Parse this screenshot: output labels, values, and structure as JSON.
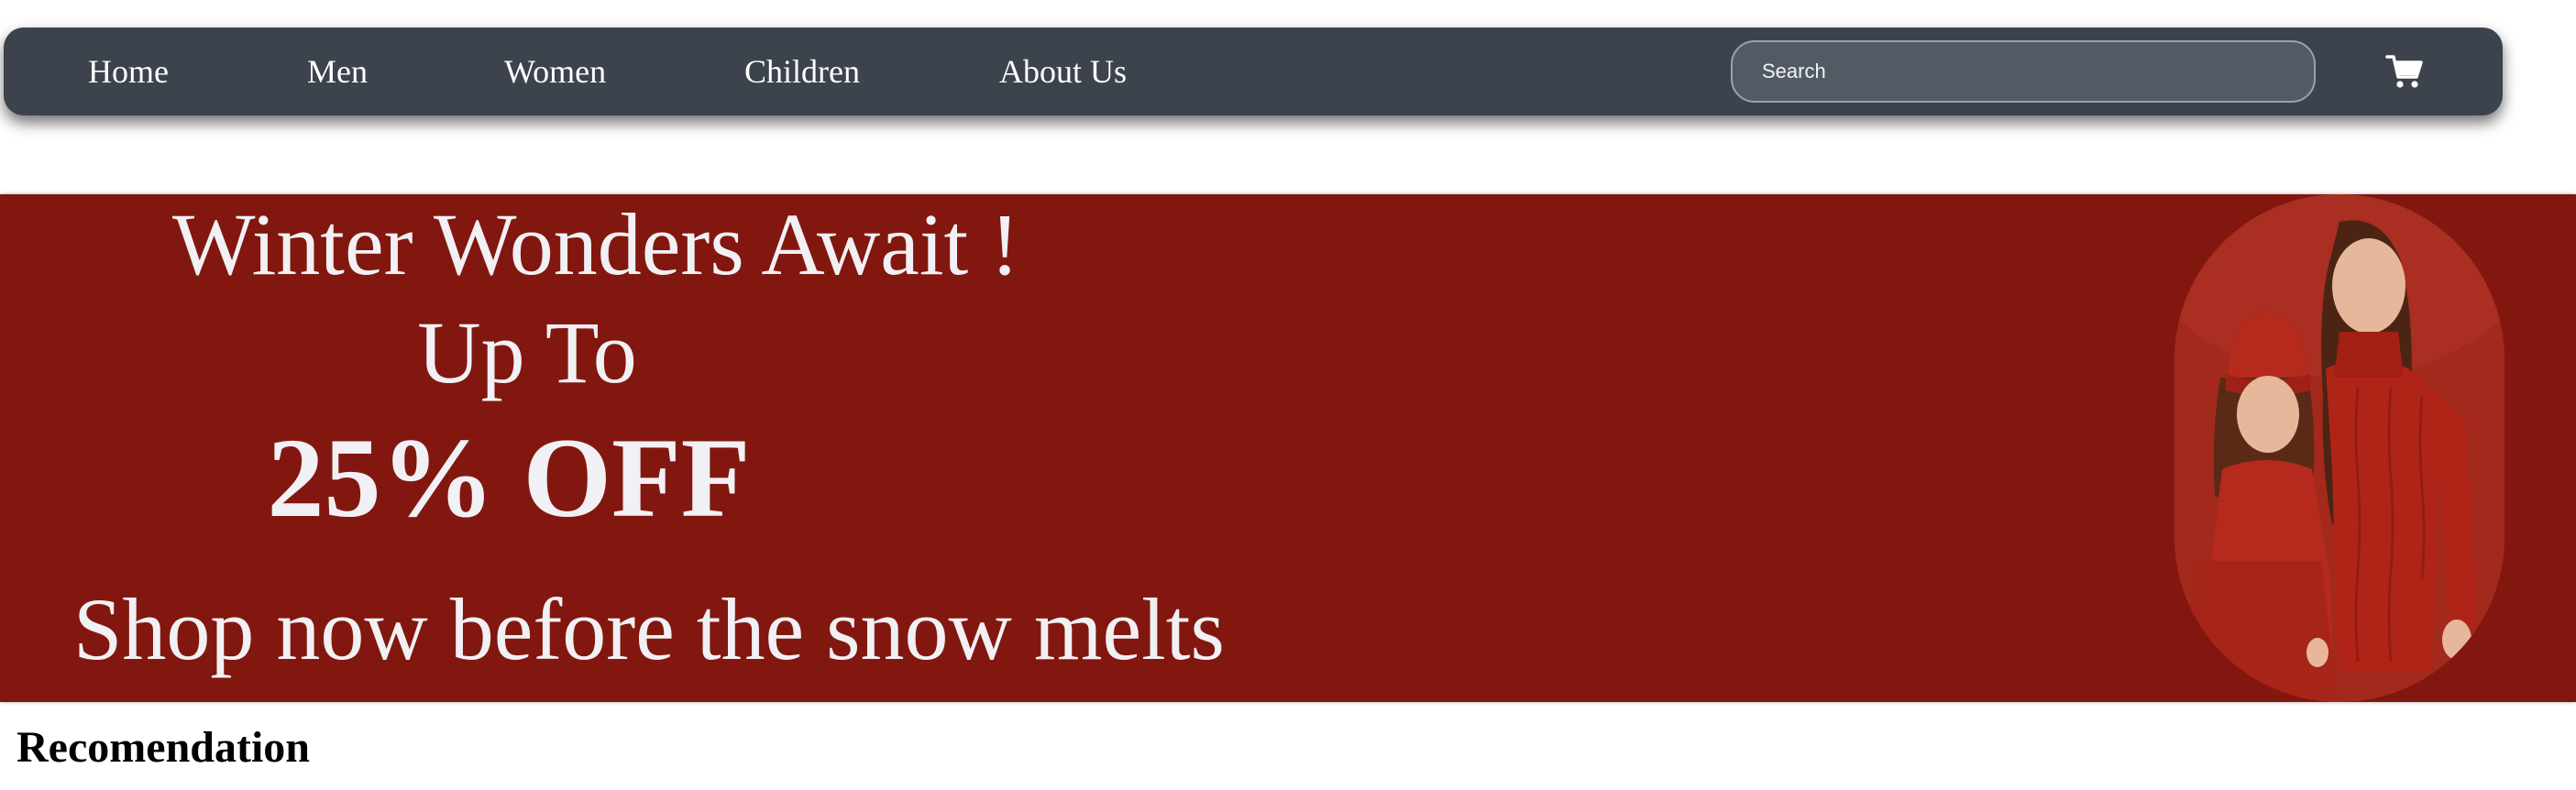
{
  "nav": {
    "links": [
      {
        "label": "Home"
      },
      {
        "label": "Men"
      },
      {
        "label": "Women"
      },
      {
        "label": "Children"
      },
      {
        "label": "About Us"
      }
    ],
    "search": {
      "placeholder": "Search",
      "value": ""
    },
    "cart_icon": "shopping-cart-icon"
  },
  "hero": {
    "headline": "Winter Wonders Await !",
    "subheadline": "Up To",
    "discount": "25% OFF",
    "tagline": "Shop now before the snow melts",
    "image_icon": "two-girls-red-knitwear-photo"
  },
  "recommendation": {
    "title": "Recomendation"
  },
  "colors": {
    "navbar_bg": "#3c434c",
    "search_bg": "#525a64",
    "hero_bg": "#82170f",
    "hero_text": "#f1f0f4"
  }
}
